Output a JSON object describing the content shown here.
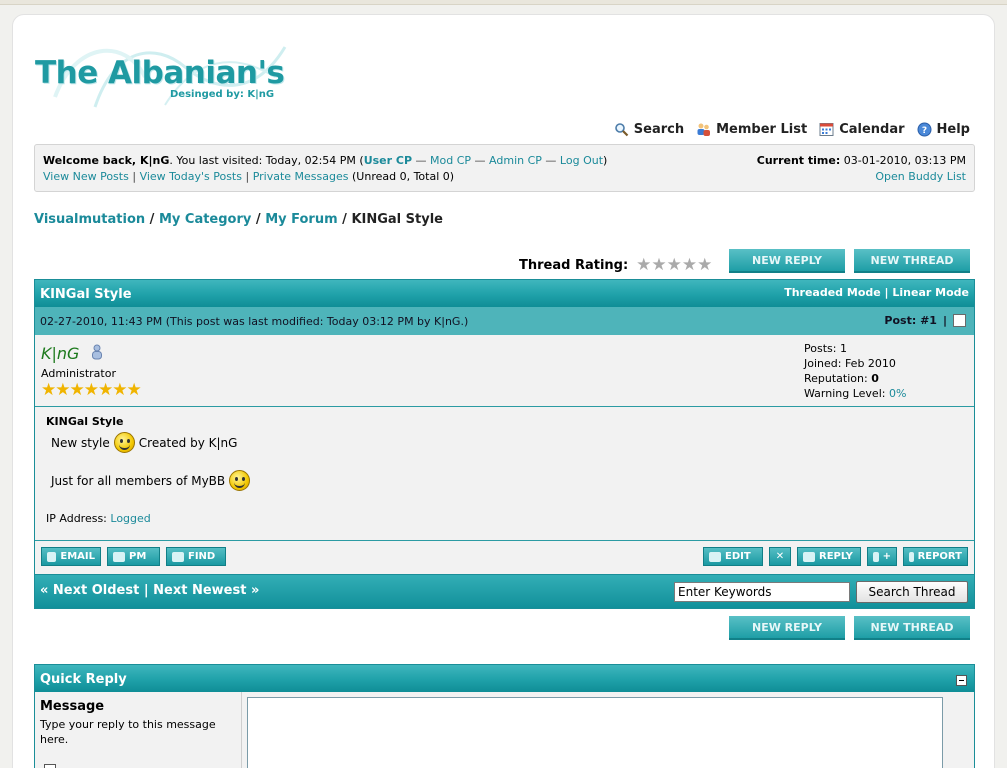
{
  "logo": {
    "title": "The Albanian's",
    "subtitle": "Desinged by: K|nG"
  },
  "menu": {
    "search": "Search",
    "member_list": "Member List",
    "calendar": "Calendar",
    "help": "Help"
  },
  "welcome": {
    "prefix": "Welcome back, K|nG",
    "visited": ". You last visited: Today, 02:54 PM (",
    "user_cp": "User CP",
    "mod_cp": "Mod CP",
    "admin_cp": "Admin CP",
    "log_out": "Log Out",
    "close_paren": ")",
    "view_new_posts": "View New Posts",
    "view_todays_posts": "View Today's Posts",
    "private_messages": "Private Messages",
    "pm_counts": "(Unread 0, Total 0)",
    "current_time_label": "Current time:",
    "current_time_value": "03-01-2010, 03:13 PM",
    "buddy_list": "Open Buddy List"
  },
  "breadcrumb": {
    "root": "Visualmutation",
    "category": "My Category",
    "forum": "My Forum",
    "current": "KINGal Style"
  },
  "thread_rating_label": "Thread Rating:",
  "buttons": {
    "new_reply": "NEW REPLY",
    "new_thread": "NEW THREAD"
  },
  "thread": {
    "title": "KINGal Style",
    "threaded_mode": "Threaded Mode",
    "linear_mode": "Linear Mode",
    "post_date": "02-27-2010, 11:43 PM (This post was last modified: Today 03:12 PM by K|nG.)",
    "post_number_label": "Post:",
    "post_number": "#1"
  },
  "author": {
    "name": "K|nG",
    "title": "Administrator",
    "posts": "Posts: 1",
    "joined": "Joined: Feb 2010",
    "reputation_label": "Reputation: ",
    "reputation_value": "0",
    "warning_label": "Warning Level: ",
    "warning_value": "0%"
  },
  "post": {
    "subject": "KINGal Style",
    "line1_a": "New style",
    "line1_b": "Created by K|nG",
    "line2": "Just for all members of MyBB",
    "ip_label": "IP Address: ",
    "ip_value": "Logged"
  },
  "post_buttons": {
    "email": "EMAIL",
    "pm": "PM",
    "find": "FIND",
    "edit": "EDIT",
    "reply": "REPLY",
    "report": "REPORT"
  },
  "footer_nav": {
    "next_oldest": "« Next Oldest",
    "next_newest": "Next Newest »",
    "search_placeholder": "Enter Keywords",
    "search_button": "Search Thread"
  },
  "quick_reply": {
    "title": "Quick Reply",
    "message_label": "Message",
    "message_hint": "Type your reply to this message here."
  }
}
